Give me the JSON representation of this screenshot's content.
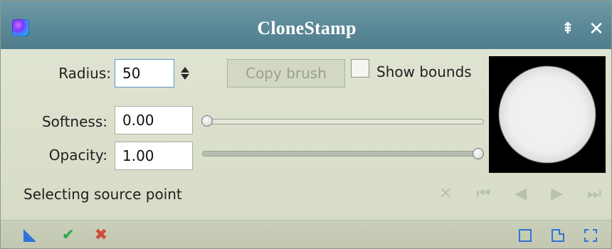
{
  "window": {
    "title": "CloneStamp",
    "title_buttons": [
      "pin",
      "close"
    ]
  },
  "form": {
    "radius_label": "Radius:",
    "radius_value": "50",
    "softness_label": "Softness:",
    "softness_value": "0.00",
    "opacity_label": "Opacity:",
    "opacity_value": "1.00",
    "copy_brush_label": "Copy brush",
    "show_bounds_label": "Show bounds",
    "show_bounds_checked": false
  },
  "sliders": {
    "softness": 0.0,
    "opacity": 1.0
  },
  "status": {
    "text": "Selecting source point"
  },
  "icons": {
    "app": "pixinsight-app-icon",
    "nav": [
      "cancel-icon",
      "first-icon",
      "previous-icon",
      "next-icon",
      "last-icon"
    ],
    "bottom_left": [
      "new-instance-icon",
      "apply-icon",
      "cancel-icon"
    ],
    "bottom_right": [
      "reset-icon",
      "document-icon",
      "expand-icon"
    ]
  },
  "colors": {
    "titlebar": "#5d8a98",
    "panel": "#d6dbc6",
    "accent_blue": "#2f73d8",
    "apply_green": "#2ea84a",
    "cancel_red": "#d24a3c"
  }
}
